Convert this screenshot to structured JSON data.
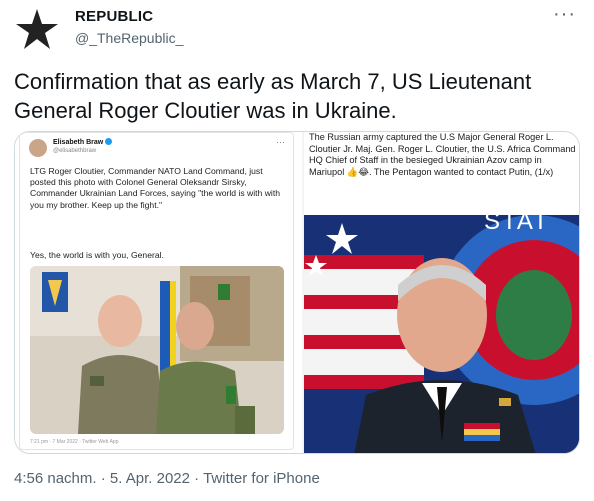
{
  "account": {
    "display_name": "REPUBLIC",
    "handle": "@_TheRepublic_",
    "avatar_icon": "star-icon"
  },
  "more_label": "···",
  "tweet": {
    "text": "Confirmation that as early as March 7, US Lieutenant General Roger Cloutier was in Ukraine."
  },
  "embedded_left": {
    "author_name": "Elisabeth Braw",
    "author_handle": "@elisabethbraw",
    "more_label": "···",
    "text": "LTG Roger Cloutier, Commander NATO Land Command, just posted this photo with Colonel General Oleksandr Sirsky, Commander Ukrainian Land Forces, saying \"the world is with with you my brother. Keep up the fight.\"",
    "text2": "Yes, the world is with you, General.",
    "timestamp": "7:21 pm · 7 Mar 2022 · Twitter Web App"
  },
  "embedded_right": {
    "text": "The Russian army captured the U.S Major General Roger L. Cloutier Jr. Maj. Gen. Roger L. Cloutier, the U.S. Africa Command HQ Chief of Staff in the besieged Ukrainian Azov camp in Mariupol 👍😂. The Pentagon wanted to contact Putin, (1/x)"
  },
  "meta": {
    "time": "4:56 nachm.",
    "date": "5. Apr. 2022",
    "source": "Twitter for iPhone",
    "separator": "·"
  },
  "colors": {
    "text_primary": "#0f1419",
    "text_secondary": "#536471",
    "border": "#cfd9de",
    "verified": "#1d9bf0"
  }
}
